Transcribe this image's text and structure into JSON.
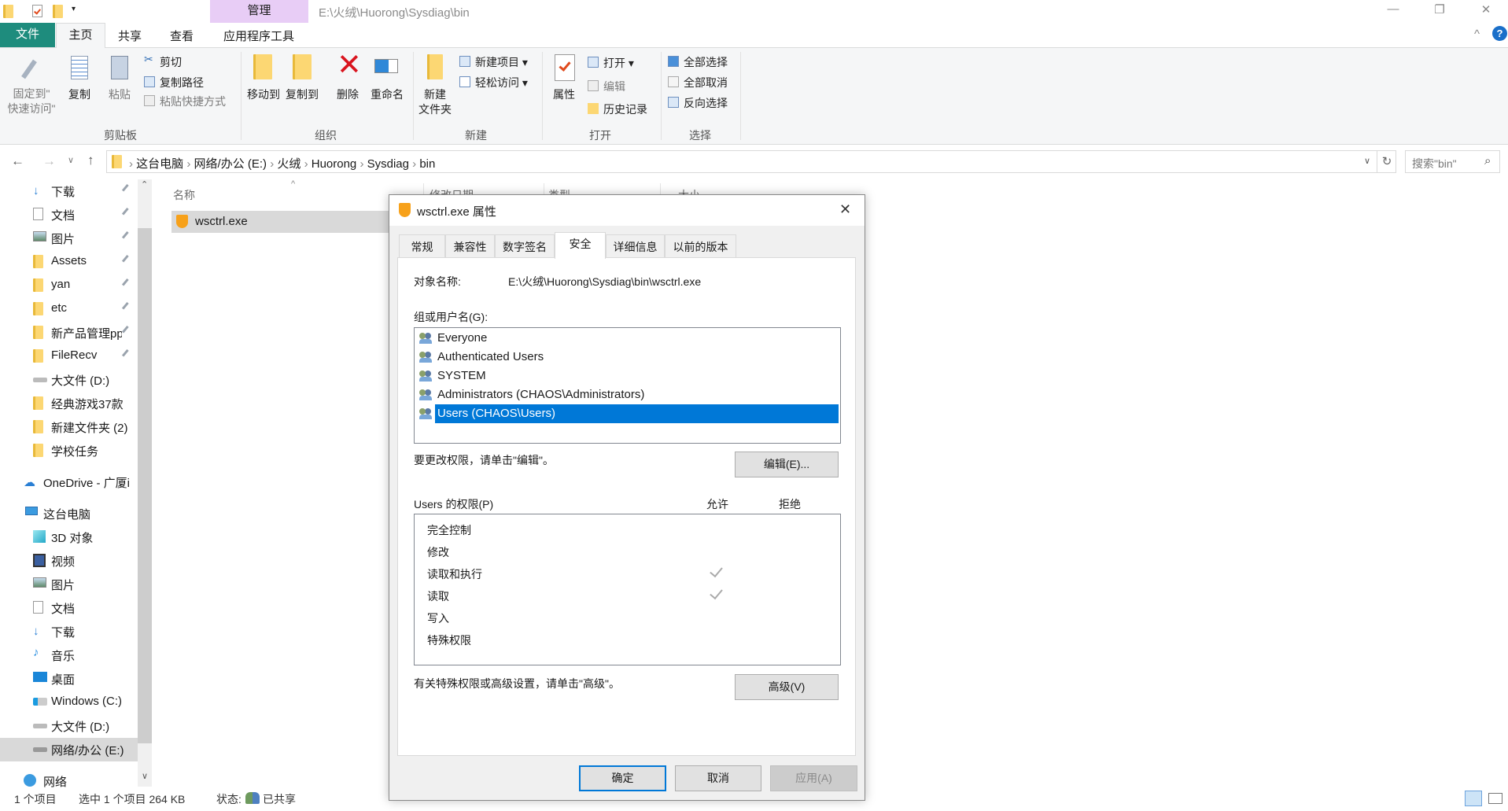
{
  "window": {
    "context_tab": "管理",
    "title_path": "E:\\火绒\\Huorong\\Sysdiag\\bin",
    "minimize": "—",
    "restore": "❐",
    "close": "✕"
  },
  "ribbon": {
    "tabs": [
      {
        "label": "文件"
      },
      {
        "label": "主页"
      },
      {
        "label": "共享"
      },
      {
        "label": "查看"
      },
      {
        "label": "应用程序工具"
      }
    ],
    "groups": {
      "clipboard": {
        "label": "剪贴板",
        "pin_line1": "固定到\"",
        "pin_line2": "快速访问\"",
        "copy": "复制",
        "paste": "粘贴",
        "cut": "剪切",
        "copy_path": "复制路径",
        "paste_shortcut": "粘贴快捷方式"
      },
      "organize": {
        "label": "组织",
        "move_to": "移动到",
        "copy_to": "复制到",
        "delete": "删除",
        "rename": "重命名"
      },
      "new": {
        "label": "新建",
        "new_folder_line1": "新建",
        "new_folder_line2": "文件夹",
        "new_item": "新建项目",
        "easy_access": "轻松访问"
      },
      "open": {
        "label": "打开",
        "properties": "属性",
        "open": "打开",
        "edit": "编辑",
        "history": "历史记录"
      },
      "select": {
        "label": "选择",
        "select_all": "全部选择",
        "select_none": "全部取消",
        "invert": "反向选择"
      }
    },
    "help": "?"
  },
  "address": {
    "crumbs": [
      "这台电脑",
      "网络/办公 (E:)",
      "火绒",
      "Huorong",
      "Sysdiag",
      "bin"
    ],
    "search_placeholder": "搜索\"bin\""
  },
  "sidebar": {
    "quick": [
      {
        "label": "下载"
      },
      {
        "label": "文档"
      },
      {
        "label": "图片"
      },
      {
        "label": "Assets"
      },
      {
        "label": "yan"
      },
      {
        "label": "etc"
      },
      {
        "label": "新产品管理pp"
      },
      {
        "label": "FileRecv"
      },
      {
        "label": "大文件 (D:)"
      },
      {
        "label": "经典游戏37款"
      },
      {
        "label": "新建文件夹 (2)"
      },
      {
        "label": "学校任务"
      }
    ],
    "onedrive": "OneDrive - 广厦i",
    "this_pc": "这台电脑",
    "pc_items": [
      {
        "label": "3D 对象"
      },
      {
        "label": "视频"
      },
      {
        "label": "图片"
      },
      {
        "label": "文档"
      },
      {
        "label": "下载"
      },
      {
        "label": "音乐"
      },
      {
        "label": "桌面"
      },
      {
        "label": "Windows (C:)"
      },
      {
        "label": "大文件 (D:)"
      },
      {
        "label": "网络/办公 (E:)"
      }
    ],
    "network": "网络"
  },
  "filelist": {
    "columns": [
      "名称",
      "修改日期",
      "类型",
      "大小"
    ],
    "files": [
      {
        "name": "wsctrl.exe"
      }
    ]
  },
  "status": {
    "count": "1 个项目",
    "selected": "选中 1 个项目  264 KB",
    "state_label": "状态:",
    "state_value": "已共享"
  },
  "dialog": {
    "title": "wsctrl.exe 属性",
    "tabs": [
      "常规",
      "兼容性",
      "数字签名",
      "安全",
      "详细信息",
      "以前的版本"
    ],
    "active_tab": "安全",
    "object_label": "对象名称:",
    "object_value": "E:\\火绒\\Huorong\\Sysdiag\\bin\\wsctrl.exe",
    "groups_label": "组或用户名(G):",
    "users": [
      "Everyone",
      "Authenticated Users",
      "SYSTEM",
      "Administrators (CHAOS\\Administrators)",
      "Users (CHAOS\\Users)"
    ],
    "selected_user": "Users (CHAOS\\Users)",
    "edit_hint": "要更改权限，请单击\"编辑\"。",
    "edit_button": "编辑(E)...",
    "perm_label": "Users 的权限(P)",
    "allow_label": "允许",
    "deny_label": "拒绝",
    "permissions": [
      {
        "name": "完全控制",
        "allow": false,
        "deny": false
      },
      {
        "name": "修改",
        "allow": false,
        "deny": false
      },
      {
        "name": "读取和执行",
        "allow": true,
        "deny": false
      },
      {
        "name": "读取",
        "allow": true,
        "deny": false
      },
      {
        "name": "写入",
        "allow": false,
        "deny": false
      },
      {
        "name": "特殊权限",
        "allow": false,
        "deny": false
      }
    ],
    "advanced_hint": "有关特殊权限或高级设置，请单击\"高级\"。",
    "advanced_button": "高级(V)",
    "ok": "确定",
    "cancel": "取消",
    "apply": "应用(A)"
  },
  "colors": {
    "accent": "#0078d7",
    "file_tab": "#1e8c7d",
    "context_tab": "#e8cdf6"
  }
}
